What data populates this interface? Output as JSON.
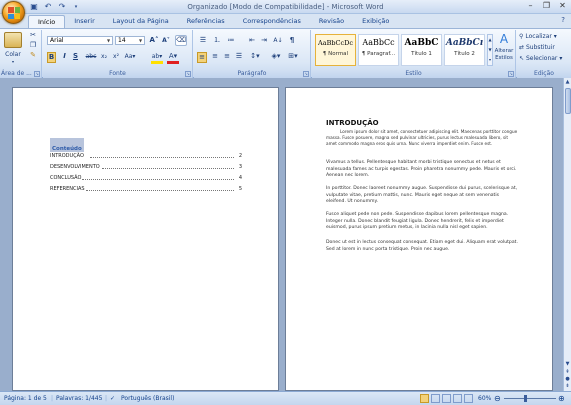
{
  "window": {
    "title": "Organizado [Modo de Compatibilidade] - Microsoft Word",
    "controls": [
      "–",
      "❐",
      "✕"
    ]
  },
  "tabs": [
    "Início",
    "Inserir",
    "Layout da Página",
    "Referências",
    "Correspondências",
    "Revisão",
    "Exibição"
  ],
  "ribbon": {
    "clipboard": {
      "paste_label": "Colar",
      "group_label": "Área de ..."
    },
    "font": {
      "name": "Arial",
      "size": "14",
      "group_label": "Fonte"
    },
    "paragraph": {
      "group_label": "Parágrafo"
    },
    "styles": {
      "items": [
        {
          "preview": "AaBbCcDc",
          "name": "¶ Normal"
        },
        {
          "preview": "AaBbCc",
          "name": "¶ Paragraf..."
        },
        {
          "preview": "AaBbC",
          "name": "Título 1"
        },
        {
          "preview": "AaBbCı",
          "name": "Título 2"
        }
      ],
      "change_label": "Alterar Estilos",
      "group_label": "Estilo"
    },
    "editing": {
      "find": "Localizar",
      "replace": "Substituir",
      "select": "Selecionar",
      "group_label": "Edição"
    }
  },
  "page1": {
    "toc_title": "Conteúdo",
    "entries": [
      {
        "label": "INTRODUÇÃO",
        "page": "2"
      },
      {
        "label": "DESENVOLVIMENTO",
        "page": "3"
      },
      {
        "label": "CONCLUSÃO",
        "page": "4"
      },
      {
        "label": "REFERENCIAS",
        "page": "5"
      }
    ]
  },
  "page2": {
    "heading": "INTRODUÇÃO",
    "paragraphs": [
      "Lorem ipsum dolor sit amet, consectetuer adipiscing elit. Maecenas porttitor congue massa. Fusce posuere, magna sed pulvinar ultricies, purus lectus malesuada libero, sit amet commodo magna eros quis urna. Nunc viverra imperdiet enim. Fusce est.",
      "Vivamus a tellus. Pellentesque habitant morbi tristique senectus et netus et malesuada fames ac turpis egestas. Proin pharetra nonummy pede. Mauris et orci. Aenean nec lorem.",
      "In porttitor. Donec laoreet nonummy augue. Suspendisse dui purus, scelerisque at, vulputate vitae, pretium mattis, nunc. Mauris eget neque at sem venenatis eleifend. Ut nonummy.",
      "Fusce aliquet pede non pede. Suspendisse dapibus lorem pellentesque magna. Integer nulla. Donec blandit feugiat ligula. Donec hendrerit, felis et imperdiet euismod, purus ipsum pretium metus, in lacinia nulla nisl eget sapien.",
      "Donec ut est in lectus consequat consequat. Etiam eget dui. Aliquam erat volutpat. Sed at lorem in nunc porta tristique. Proin nec augue."
    ]
  },
  "status": {
    "page": "Página: 1 de 5",
    "words": "Palavras: 1/445",
    "language": "Português (Brasil)",
    "zoom": "60%"
  }
}
